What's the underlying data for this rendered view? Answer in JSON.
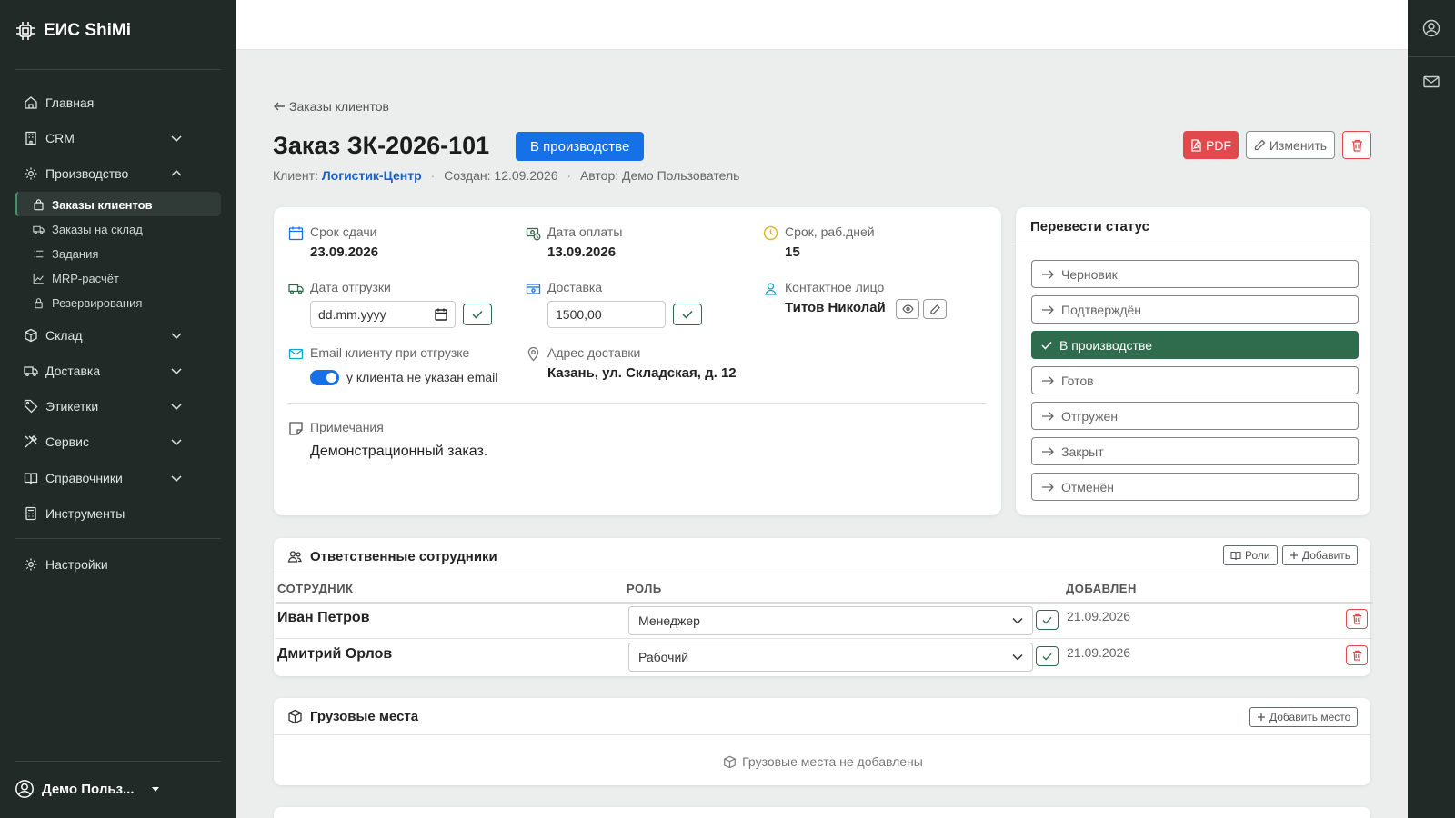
{
  "app": {
    "brand": "ЕИС ShiMi"
  },
  "sidebar": {
    "items": [
      {
        "label": "Главная"
      },
      {
        "label": "CRM"
      },
      {
        "label": "Производство"
      },
      {
        "label": "Склад"
      },
      {
        "label": "Доставка"
      },
      {
        "label": "Этикетки"
      },
      {
        "label": "Сервис"
      },
      {
        "label": "Справочники"
      },
      {
        "label": "Инструменты"
      },
      {
        "label": "Настройки"
      }
    ],
    "sub_items": [
      {
        "label": "Заказы клиентов"
      },
      {
        "label": "Заказы на склад"
      },
      {
        "label": "Задания"
      },
      {
        "label": "MRP-расчёт"
      },
      {
        "label": "Резервирования"
      }
    ],
    "user": "Демо Польз..."
  },
  "page": {
    "back": "Заказы клиентов",
    "title": "Заказ ЗК-2026-101",
    "status_badge": "В производстве",
    "meta": {
      "client_label": "Клиент:",
      "client": "Логистик-Центр",
      "created": "Создан: 12.09.2026",
      "author": "Автор: Демо Пользователь"
    },
    "actions": {
      "pdf": "PDF",
      "edit": "Изменить"
    }
  },
  "details": {
    "due_label": "Срок сдачи",
    "due": "23.09.2026",
    "pay_label": "Дата оплаты",
    "pay": "13.09.2026",
    "days_label": "Срок, раб.дней",
    "days": "15",
    "ship_label": "Дата отгрузки",
    "ship_placeholder": "dd.mm.yyyy",
    "delivery_label": "Доставка",
    "delivery": "1500,00",
    "contact_label": "Контактное лицо",
    "contact": "Титов Николай",
    "email_label": "Email клиенту при отгрузке",
    "email_note": "у клиента не указан email",
    "address_label": "Адрес доставки",
    "address": "Казань, ул. Складская, д. 12",
    "notes_label": "Примечания",
    "notes": "Демонстрационный заказ."
  },
  "status_panel": {
    "title": "Перевести статус",
    "options": [
      {
        "label": "Черновик",
        "active": false
      },
      {
        "label": "Подтверждён",
        "active": false
      },
      {
        "label": "В производстве",
        "active": true
      },
      {
        "label": "Готов",
        "active": false
      },
      {
        "label": "Отгружен",
        "active": false
      },
      {
        "label": "Закрыт",
        "active": false
      },
      {
        "label": "Отменён",
        "active": false
      }
    ]
  },
  "staff": {
    "title": "Ответственные сотрудники",
    "roles_btn": "Роли",
    "add_btn": "Добавить",
    "columns": [
      "СОТРУДНИК",
      "РОЛЬ",
      "ДОБАВЛЕН"
    ],
    "rows": [
      {
        "name": "Иван Петров",
        "role": "Менеджер",
        "added": "21.09.2026"
      },
      {
        "name": "Дмитрий Орлов",
        "role": "Рабочий",
        "added": "21.09.2026"
      }
    ]
  },
  "cargo": {
    "title": "Грузовые места",
    "add_btn": "Добавить место",
    "empty": "Грузовые места не добавлены"
  },
  "colors": {
    "primary": "#1670e8",
    "sidebar": "#212a27",
    "active_status": "#2f6b4d",
    "danger": "#e04a4c"
  }
}
